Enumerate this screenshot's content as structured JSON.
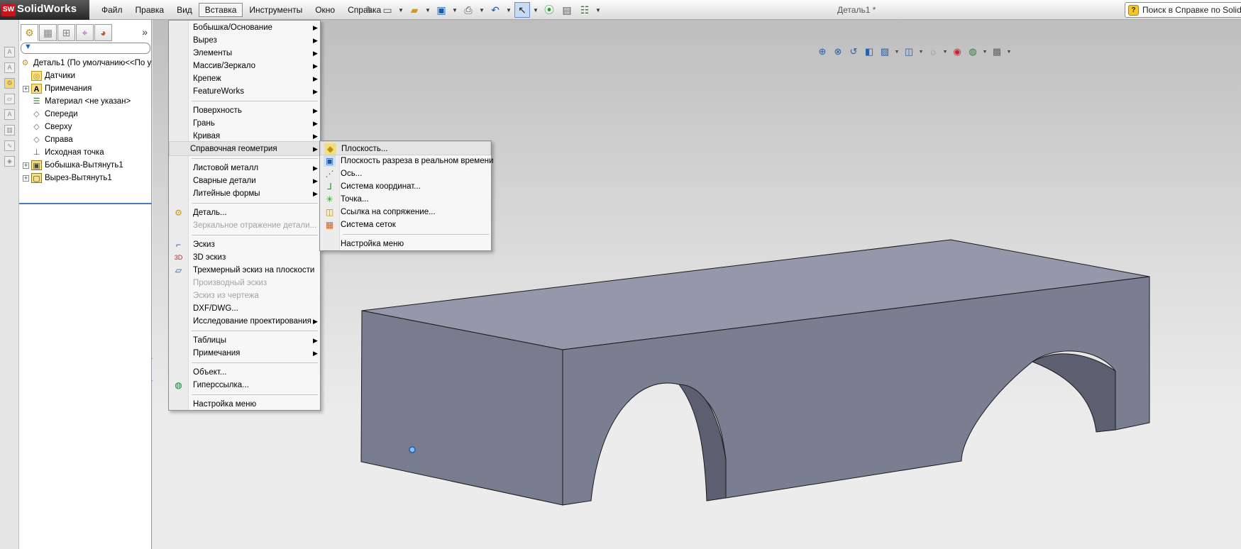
{
  "app": {
    "logo_badge": "SW",
    "logo_text": "SolidWorks",
    "document_title": "Деталь1 *"
  },
  "menubar": {
    "items": [
      {
        "label": "Файл",
        "active": false
      },
      {
        "label": "Правка",
        "active": false
      },
      {
        "label": "Вид",
        "active": false
      },
      {
        "label": "Вставка",
        "active": true
      },
      {
        "label": "Инструменты",
        "active": false
      },
      {
        "label": "Окно",
        "active": false
      },
      {
        "label": "Справка",
        "active": false
      }
    ]
  },
  "toolbar": {
    "icons": [
      "pushpin-icon",
      "new-document-icon",
      "open-folder-icon",
      "save-icon",
      "print-icon",
      "undo-icon",
      "select-arrow-icon",
      "rebuild-traffic-light-icon",
      "file-properties-icon",
      "options-icon"
    ]
  },
  "help_search": {
    "placeholder": "Поиск в Справке по SolidWorks"
  },
  "feature_manager": {
    "tabs": [
      "feature-tree-tab",
      "property-manager-tab",
      "configuration-manager-tab",
      "dim-xpert-tab",
      "display-manager-tab"
    ],
    "filter_icon": "filter-icon",
    "tree": [
      {
        "label": "Деталь1  (По умолчанию<<По у",
        "icon": "part-icon",
        "expandable": false,
        "level": 0
      },
      {
        "label": "Датчики",
        "icon": "sensor-icon",
        "expandable": false,
        "level": 1
      },
      {
        "label": "Примечания",
        "icon": "annotations-icon",
        "expandable": true,
        "level": 1
      },
      {
        "label": "Материал <не указан>",
        "icon": "material-icon",
        "expandable": false,
        "level": 1
      },
      {
        "label": "Спереди",
        "icon": "plane-icon",
        "expandable": false,
        "level": 1
      },
      {
        "label": "Сверху",
        "icon": "plane-icon",
        "expandable": false,
        "level": 1
      },
      {
        "label": "Справа",
        "icon": "plane-icon",
        "expandable": false,
        "level": 1
      },
      {
        "label": "Исходная точка",
        "icon": "origin-icon",
        "expandable": false,
        "level": 1
      },
      {
        "label": "Бобышка-Вытянуть1",
        "icon": "extrude-boss-icon",
        "expandable": true,
        "level": 1
      },
      {
        "label": "Вырез-Вытянуть1",
        "icon": "extrude-cut-icon",
        "expandable": true,
        "level": 1
      }
    ]
  },
  "insert_menu": {
    "items": [
      {
        "label": "Бобышка/Основание",
        "submenu": true
      },
      {
        "label": "Вырез",
        "submenu": true
      },
      {
        "label": "Элементы",
        "submenu": true
      },
      {
        "label": "Массив/Зеркало",
        "submenu": true
      },
      {
        "label": "Крепеж",
        "submenu": true
      },
      {
        "label": "FeatureWorks",
        "submenu": true
      },
      {
        "separator": true
      },
      {
        "label": "Поверхность",
        "submenu": true
      },
      {
        "label": "Грань",
        "submenu": true
      },
      {
        "label": "Кривая",
        "submenu": true
      },
      {
        "label": "Справочная геометрия",
        "submenu": true,
        "highlighted": true
      },
      {
        "separator": true
      },
      {
        "label": "Листовой металл",
        "submenu": true
      },
      {
        "label": "Сварные детали",
        "submenu": true
      },
      {
        "label": "Литейные формы",
        "submenu": true
      },
      {
        "separator": true
      },
      {
        "label": "Деталь...",
        "icon": "part-insert-icon"
      },
      {
        "label": "Зеркальное отражение детали...",
        "disabled": true
      },
      {
        "separator": true
      },
      {
        "label": "Эскиз",
        "icon": "sketch-icon"
      },
      {
        "label": "3D эскиз",
        "icon": "sketch-3d-icon"
      },
      {
        "label": "Трехмерный эскиз на плоскости",
        "icon": "sketch-3d-plane-icon"
      },
      {
        "label": "Производный эскиз",
        "disabled": true
      },
      {
        "label": "Эскиз из чертежа",
        "disabled": true
      },
      {
        "label": "DXF/DWG..."
      },
      {
        "label": "Исследование проектирования",
        "submenu": true
      },
      {
        "separator": true
      },
      {
        "label": "Таблицы",
        "submenu": true
      },
      {
        "label": "Примечания",
        "submenu": true
      },
      {
        "separator": true
      },
      {
        "label": "Объект..."
      },
      {
        "label": "Гиперссылка...",
        "icon": "hyperlink-globe-icon"
      },
      {
        "separator": true
      },
      {
        "label": "Настройка меню"
      }
    ]
  },
  "reference_geometry_menu": {
    "items": [
      {
        "label": "Плоскость...",
        "icon": "plane-insert-icon",
        "highlighted": true
      },
      {
        "label": "Плоскость разреза в реальном времени",
        "icon": "live-section-plane-icon"
      },
      {
        "label": "Ось...",
        "icon": "axis-icon"
      },
      {
        "label": "Система координат...",
        "icon": "coordinate-system-icon"
      },
      {
        "label": "Точка...",
        "icon": "point-icon"
      },
      {
        "label": "Ссылка на сопряжение...",
        "icon": "mate-reference-icon"
      },
      {
        "label": "Система сеток",
        "icon": "grid-system-icon"
      },
      {
        "separator": true
      },
      {
        "label": "Настройка меню"
      }
    ]
  },
  "heads_up_toolbar": {
    "icons": [
      "zoom-to-fit-icon",
      "zoom-to-area-icon",
      "previous-view-icon",
      "section-view-icon",
      "view-orientation-icon",
      "display-style-icon",
      "hide-show-items-icon",
      "edit-appearance-icon",
      "apply-scene-icon",
      "view-settings-icon"
    ]
  },
  "colors": {
    "model_top": "#9498aa",
    "model_front": "#7a7e91",
    "model_side": "#626578",
    "menu_bg": "#f7f7f7"
  }
}
